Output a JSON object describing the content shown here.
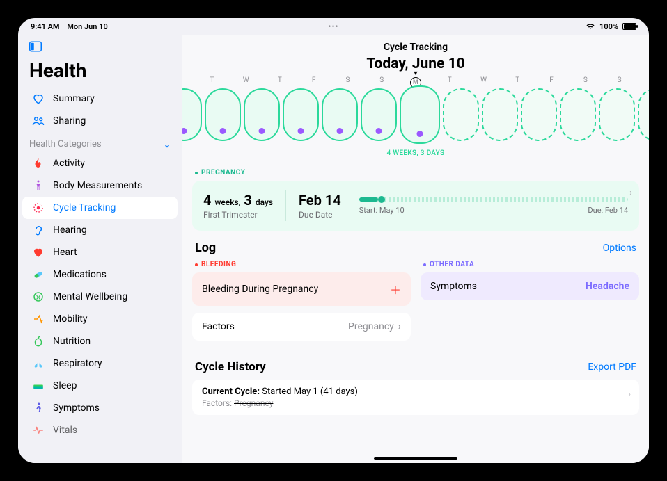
{
  "statusbar": {
    "time": "9:41 AM",
    "date": "Mon Jun 10",
    "battery": "100%"
  },
  "app_title": "Health",
  "sidebar": {
    "summary": "Summary",
    "sharing": "Sharing",
    "categories_header": "Health Categories",
    "items": [
      {
        "label": "Activity"
      },
      {
        "label": "Body Measurements"
      },
      {
        "label": "Cycle Tracking"
      },
      {
        "label": "Hearing"
      },
      {
        "label": "Heart"
      },
      {
        "label": "Medications"
      },
      {
        "label": "Mental Wellbeing"
      },
      {
        "label": "Mobility"
      },
      {
        "label": "Nutrition"
      },
      {
        "label": "Respiratory"
      },
      {
        "label": "Sleep"
      },
      {
        "label": "Symptoms"
      },
      {
        "label": "Vitals"
      }
    ]
  },
  "main": {
    "title": "Cycle Tracking",
    "today": "Today, June 10",
    "day_letters": [
      "T",
      "W",
      "T",
      "F",
      "S",
      "S",
      "M",
      "T",
      "W",
      "T",
      "F",
      "S",
      "S"
    ],
    "today_letter": "M",
    "gestation_label": "4 WEEKS, 3 DAYS",
    "pregnancy_section_label": "PREGNANCY",
    "pregnancy": {
      "weeks_num": "4",
      "weeks_unit": "weeks,",
      "days_num": "3",
      "days_unit": "days",
      "trimester": "First Trimester",
      "due_date": "Feb 14",
      "due_label": "Due Date",
      "start_label": "Start: May 10",
      "due_bar_label": "Due: Feb 14"
    },
    "log": {
      "heading": "Log",
      "options": "Options",
      "bleeding_label": "BLEEDING",
      "bleeding_item": "Bleeding During Pregnancy",
      "factors_label": "Factors",
      "factors_value": "Pregnancy",
      "other_label": "OTHER DATA",
      "symptoms_label": "Symptoms",
      "symptoms_value": "Headache"
    },
    "history": {
      "heading": "Cycle History",
      "export": "Export PDF",
      "current_prefix": "Current Cycle:",
      "current_text": "Started May 1 (41 days)",
      "factors_prefix": "Factors:",
      "factors_value": "Pregnancy"
    }
  }
}
